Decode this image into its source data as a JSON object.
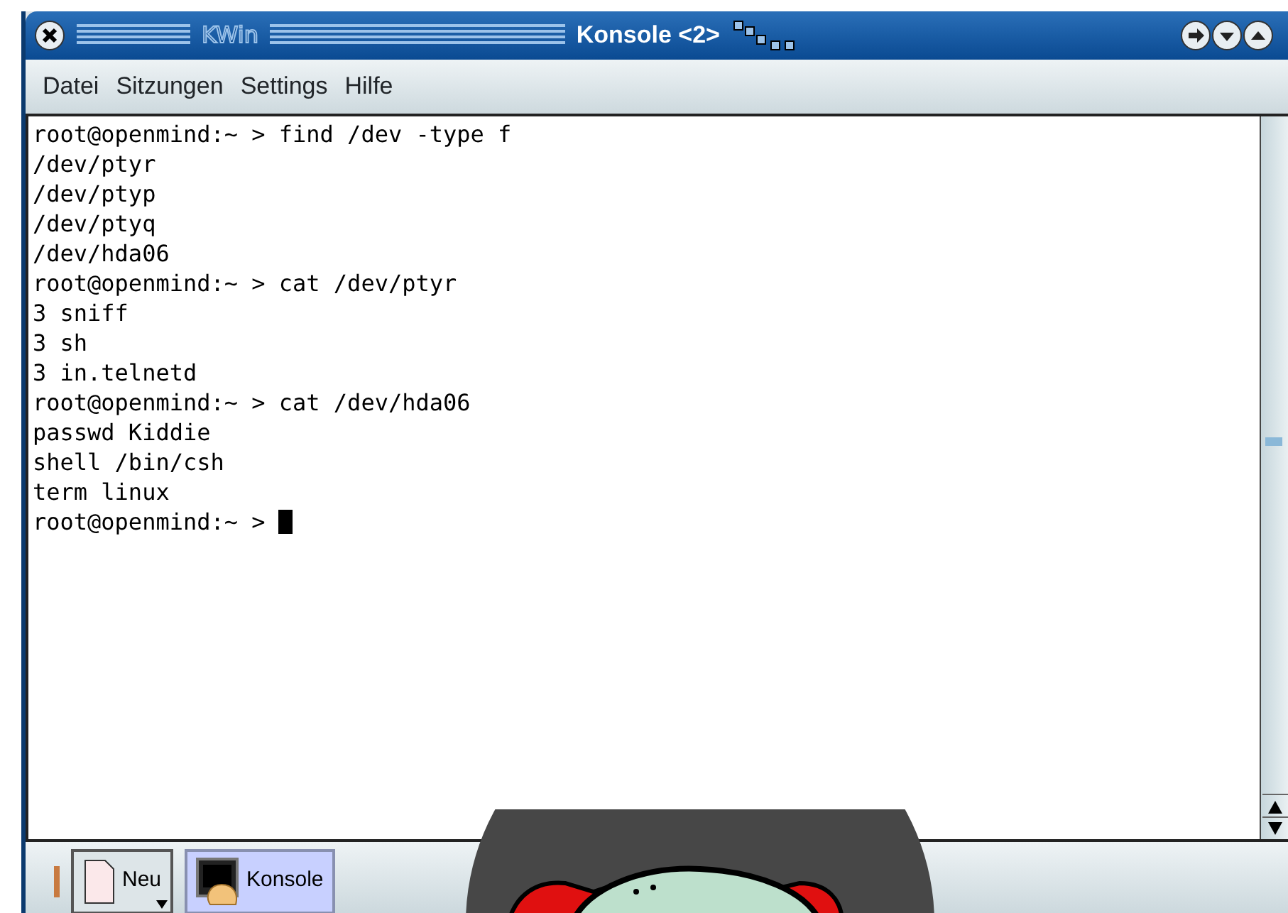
{
  "window": {
    "title": "Konsole <2>",
    "logo": "KWin"
  },
  "menu": [
    "Datei",
    "Sitzungen",
    "Settings",
    "Hilfe"
  ],
  "terminal": {
    "lines": [
      "root@openmind:~ > find /dev -type f",
      "/dev/ptyr",
      "/dev/ptyp",
      "/dev/ptyq",
      "/dev/hda06",
      "root@openmind:~ > cat /dev/ptyr",
      "3 sniff",
      "3 sh",
      "3 in.telnetd",
      "root@openmind:~ > cat /dev/hda06",
      "passwd Kiddie",
      "shell /bin/csh",
      "term linux",
      "root@openmind:~ > "
    ]
  },
  "taskbar": {
    "new_button": "Neu",
    "tasks": [
      {
        "label": "Konsole",
        "selected": true
      }
    ]
  }
}
